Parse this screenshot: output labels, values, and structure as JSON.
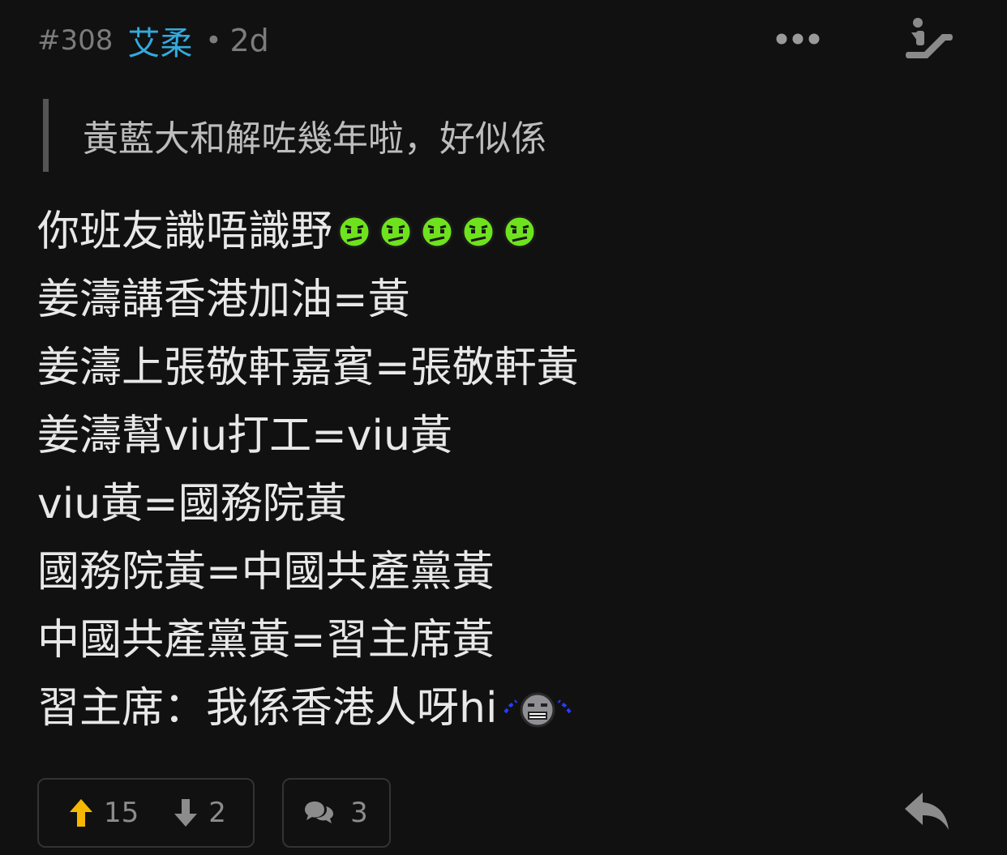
{
  "header": {
    "post_number": "#308",
    "username": "艾柔",
    "separator": "•",
    "time_ago": "2d"
  },
  "quote": {
    "text": "黃藍大和解咗幾年啦，好似係"
  },
  "content": {
    "lines": [
      "你班友識唔識野",
      "姜濤講香港加油=黃",
      "姜濤上張敬軒嘉賓=張敬軒黃",
      "姜濤幫viu打工=viu黃",
      "viu黃=國務院黃",
      "國務院黃=中國共產黨黃",
      "中國共產黨黃=習主席黃",
      "習主席：我係香港人呀hi"
    ],
    "emoji_after_line_1": "green-frown-emoji",
    "emoji_after_line_1_count": 5,
    "emoji_after_line_8": "crying-emoji"
  },
  "actions": {
    "upvote_count": "15",
    "downvote_count": "2",
    "comment_count": "3"
  },
  "colors": {
    "background": "#111111",
    "username": "#34aadc",
    "upvote": "#f5b800",
    "muted": "#8c8c8c",
    "emoji_green": "#6ee31d"
  },
  "icons": [
    "more-horizontal-icon",
    "escalator-icon",
    "arrow-up-icon",
    "arrow-down-icon",
    "comment-icon",
    "reply-icon"
  ]
}
